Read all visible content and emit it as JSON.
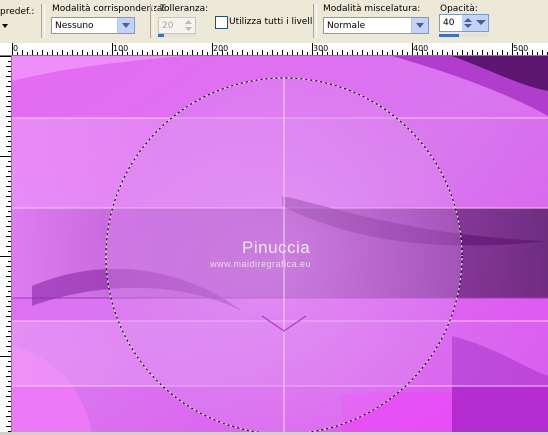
{
  "toolbar": {
    "preset_label": "predef.:",
    "match_mode": {
      "label": "Modalità corrispondenza:",
      "value": "Nessuno"
    },
    "tolerance": {
      "label": "Tolleranza:",
      "value": "20"
    },
    "use_all_layers": {
      "label": "Utilizza tutti i livelli",
      "checked": false
    },
    "blend_mode": {
      "label": "Modalità miscelatura:",
      "value": "Normale"
    },
    "opacity": {
      "label": "Opacità:",
      "value": "40"
    }
  },
  "ruler": {
    "labels": [
      "0",
      "100",
      "200",
      "300",
      "400",
      "500"
    ]
  },
  "canvas": {
    "watermark_name": "Pinuccia",
    "watermark_site": "www.maidiregrafica.eu",
    "colors": {
      "magenta": "#e04ef2",
      "lilac": "#dc8cf0",
      "purple": "#7a1e92",
      "pink": "#f07cf8"
    }
  }
}
